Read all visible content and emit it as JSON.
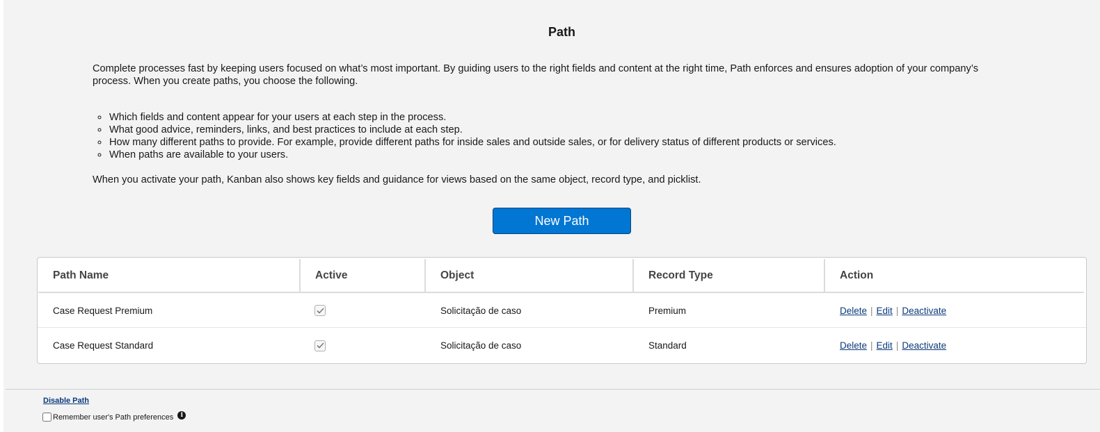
{
  "page": {
    "title": "Path",
    "intro": "Complete processes fast by keeping users focused on what’s most important. By guiding users to the right fields and content at the right time, Path enforces and ensures adoption of your company’s process. When you create paths, you choose the following.",
    "bullets": [
      "Which fields and content appear for your users at each step in the process.",
      "What good advice, reminders, links, and best practices to include at each step.",
      "How many different paths to provide. For example, provide different paths for inside sales and outside sales, or for delivery status of different products or services.",
      "When paths are available to your users."
    ],
    "outro": "When you activate your path, Kanban also shows key fields and guidance for views based on the same object, record type, and picklist.",
    "new_path_label": "New Path"
  },
  "table": {
    "headers": [
      "Path Name",
      "Active",
      "Object",
      "Record Type",
      "Action"
    ],
    "rows": [
      {
        "name": "Case Request Premium",
        "active": true,
        "object": "Solicitação de caso",
        "record_type": "Premium"
      },
      {
        "name": "Case Request Standard",
        "active": true,
        "object": "Solicitação de caso",
        "record_type": "Standard"
      }
    ],
    "actions": {
      "delete": "Delete",
      "edit": "Edit",
      "deactivate": "Deactivate",
      "separator": "|"
    }
  },
  "footer": {
    "disable_link": "Disable Path",
    "remember_label": "Remember user's Path preferences",
    "remember_checked": false,
    "info_icon": "info-icon",
    "info_glyph": "i"
  },
  "colors": {
    "accent": "#0176d3",
    "link": "#0b3a7a"
  }
}
